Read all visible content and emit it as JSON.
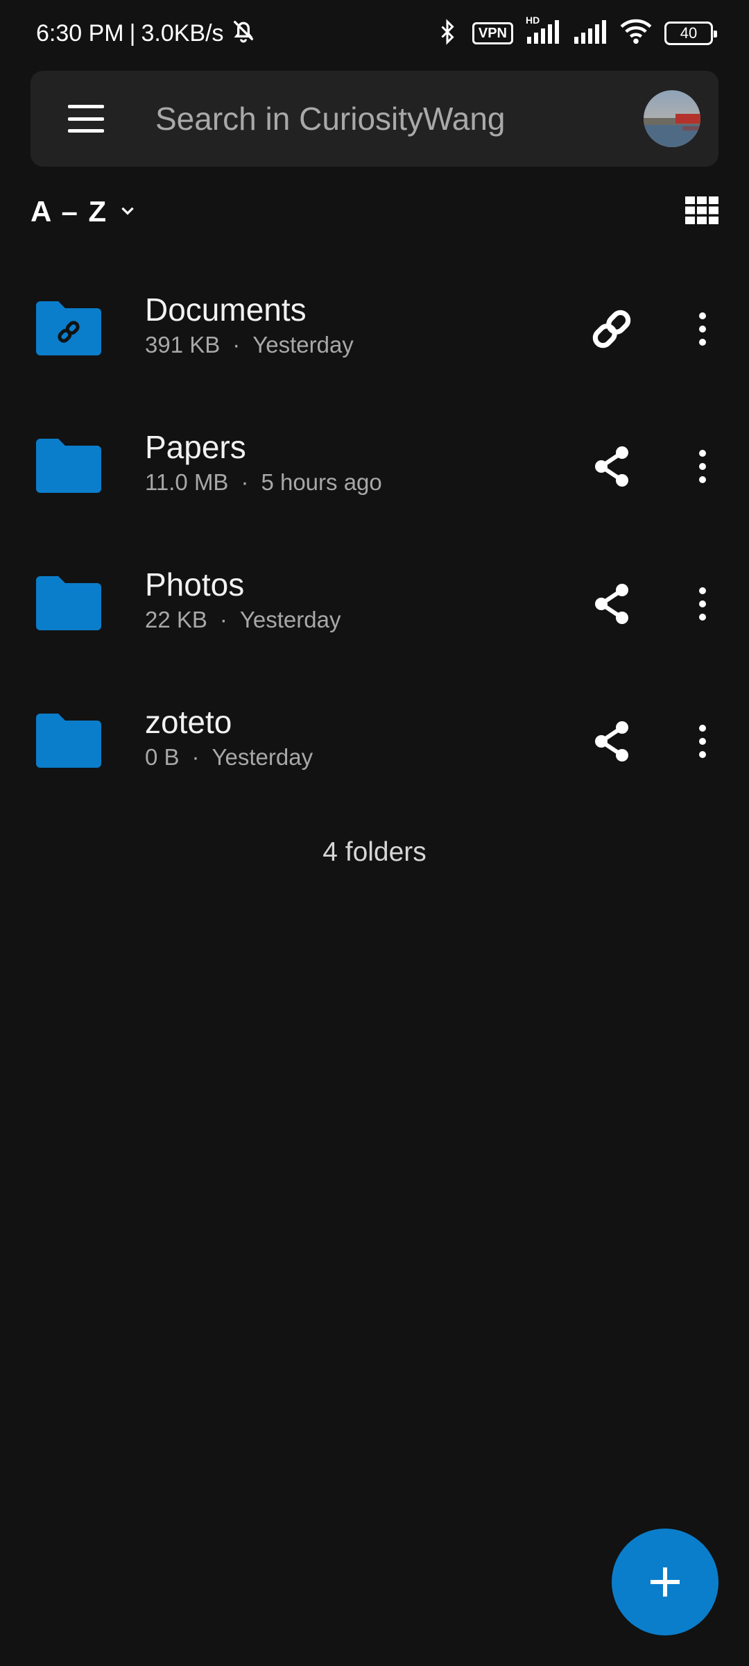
{
  "status_bar": {
    "time": "6:30 PM",
    "separator": "|",
    "speed": "3.0KB/s",
    "vpn": "VPN",
    "hd": "HD",
    "battery": "40"
  },
  "search": {
    "placeholder": "Search in CuriosityWang"
  },
  "sort": {
    "label": "A – Z"
  },
  "folders": [
    {
      "name": "Documents",
      "size": "391 KB",
      "dot": "·",
      "modified": "Yesterday",
      "action": "link-icon"
    },
    {
      "name": "Papers",
      "size": "11.0 MB",
      "dot": "·",
      "modified": "5 hours ago",
      "action": "share-icon"
    },
    {
      "name": "Photos",
      "size": "22 KB",
      "dot": "·",
      "modified": "Yesterday",
      "action": "share-icon"
    },
    {
      "name": "zoteto",
      "size": "0 B",
      "dot": "·",
      "modified": "Yesterday",
      "action": "share-icon"
    }
  ],
  "summary": {
    "count_label": "4 folders"
  },
  "colors": {
    "background": "#121212",
    "search_bg": "#222222",
    "accent": "#0a7ecb",
    "folder": "#0a7ecb"
  }
}
